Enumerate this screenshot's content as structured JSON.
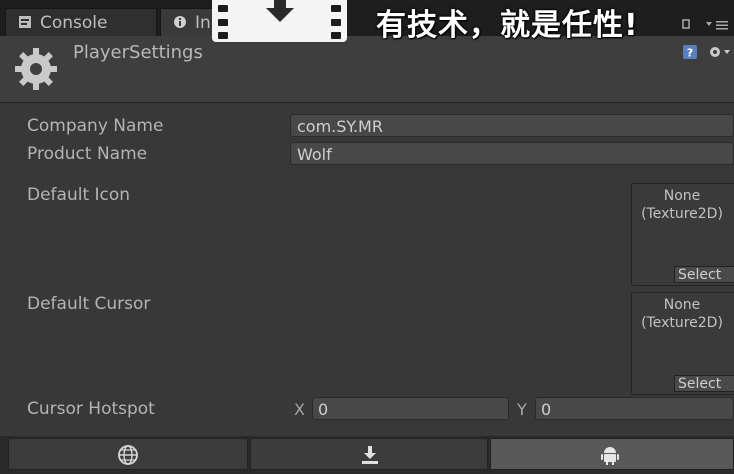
{
  "tabs": [
    {
      "label": "Console"
    },
    {
      "label": "In"
    }
  ],
  "watermark": {
    "text": "有技术，就是任性!"
  },
  "header": {
    "title": "PlayerSettings"
  },
  "fields": {
    "company_name": {
      "label": "Company Name",
      "value": "com.SY.MR"
    },
    "product_name": {
      "label": "Product Name",
      "value": "Wolf"
    },
    "default_icon": {
      "label": "Default Icon",
      "value_line1": "None",
      "value_line2": "(Texture2D)",
      "select": "Select"
    },
    "default_cursor": {
      "label": "Default Cursor",
      "value_line1": "None",
      "value_line2": "(Texture2D)",
      "select": "Select"
    },
    "cursor_hotspot": {
      "label": "Cursor Hotspot",
      "x_label": "X",
      "x_value": "0",
      "y_label": "Y",
      "y_value": "0"
    }
  },
  "platforms": [
    {
      "icon": "globe-icon"
    },
    {
      "icon": "download-icon"
    },
    {
      "icon": "android-icon"
    }
  ],
  "colors": {
    "panel": "#383838",
    "field": "#484848",
    "text": "#b4b4b4"
  }
}
